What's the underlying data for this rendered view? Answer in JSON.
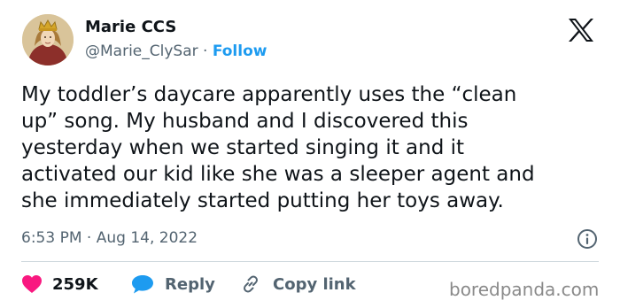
{
  "author": {
    "name": "Marie CCS",
    "handle": "@Marie_ClySar",
    "separator": " · ",
    "follow_label": "Follow",
    "avatar_icon": "medieval-queen-portrait"
  },
  "platform_icon": "x-logo-icon",
  "tweet": {
    "lines": [
      "My toddler’s daycare apparently uses the “clean",
      "up” song. My husband and I discovered this",
      "yesterday when we started singing it and it",
      "activated our kid like she was a sleeper agent and",
      "she immediately started putting her toys away."
    ],
    "time": "6:53 PM",
    "date_separator": " · ",
    "date": "Aug 14, 2022"
  },
  "actions": {
    "like_count": "259K",
    "reply_label": "Reply",
    "copy_link_label": "Copy link"
  },
  "colors": {
    "accent": "#1d9bf0",
    "like": "#f91880",
    "secondary_text": "#536471"
  },
  "watermark": "boredpanda.com"
}
